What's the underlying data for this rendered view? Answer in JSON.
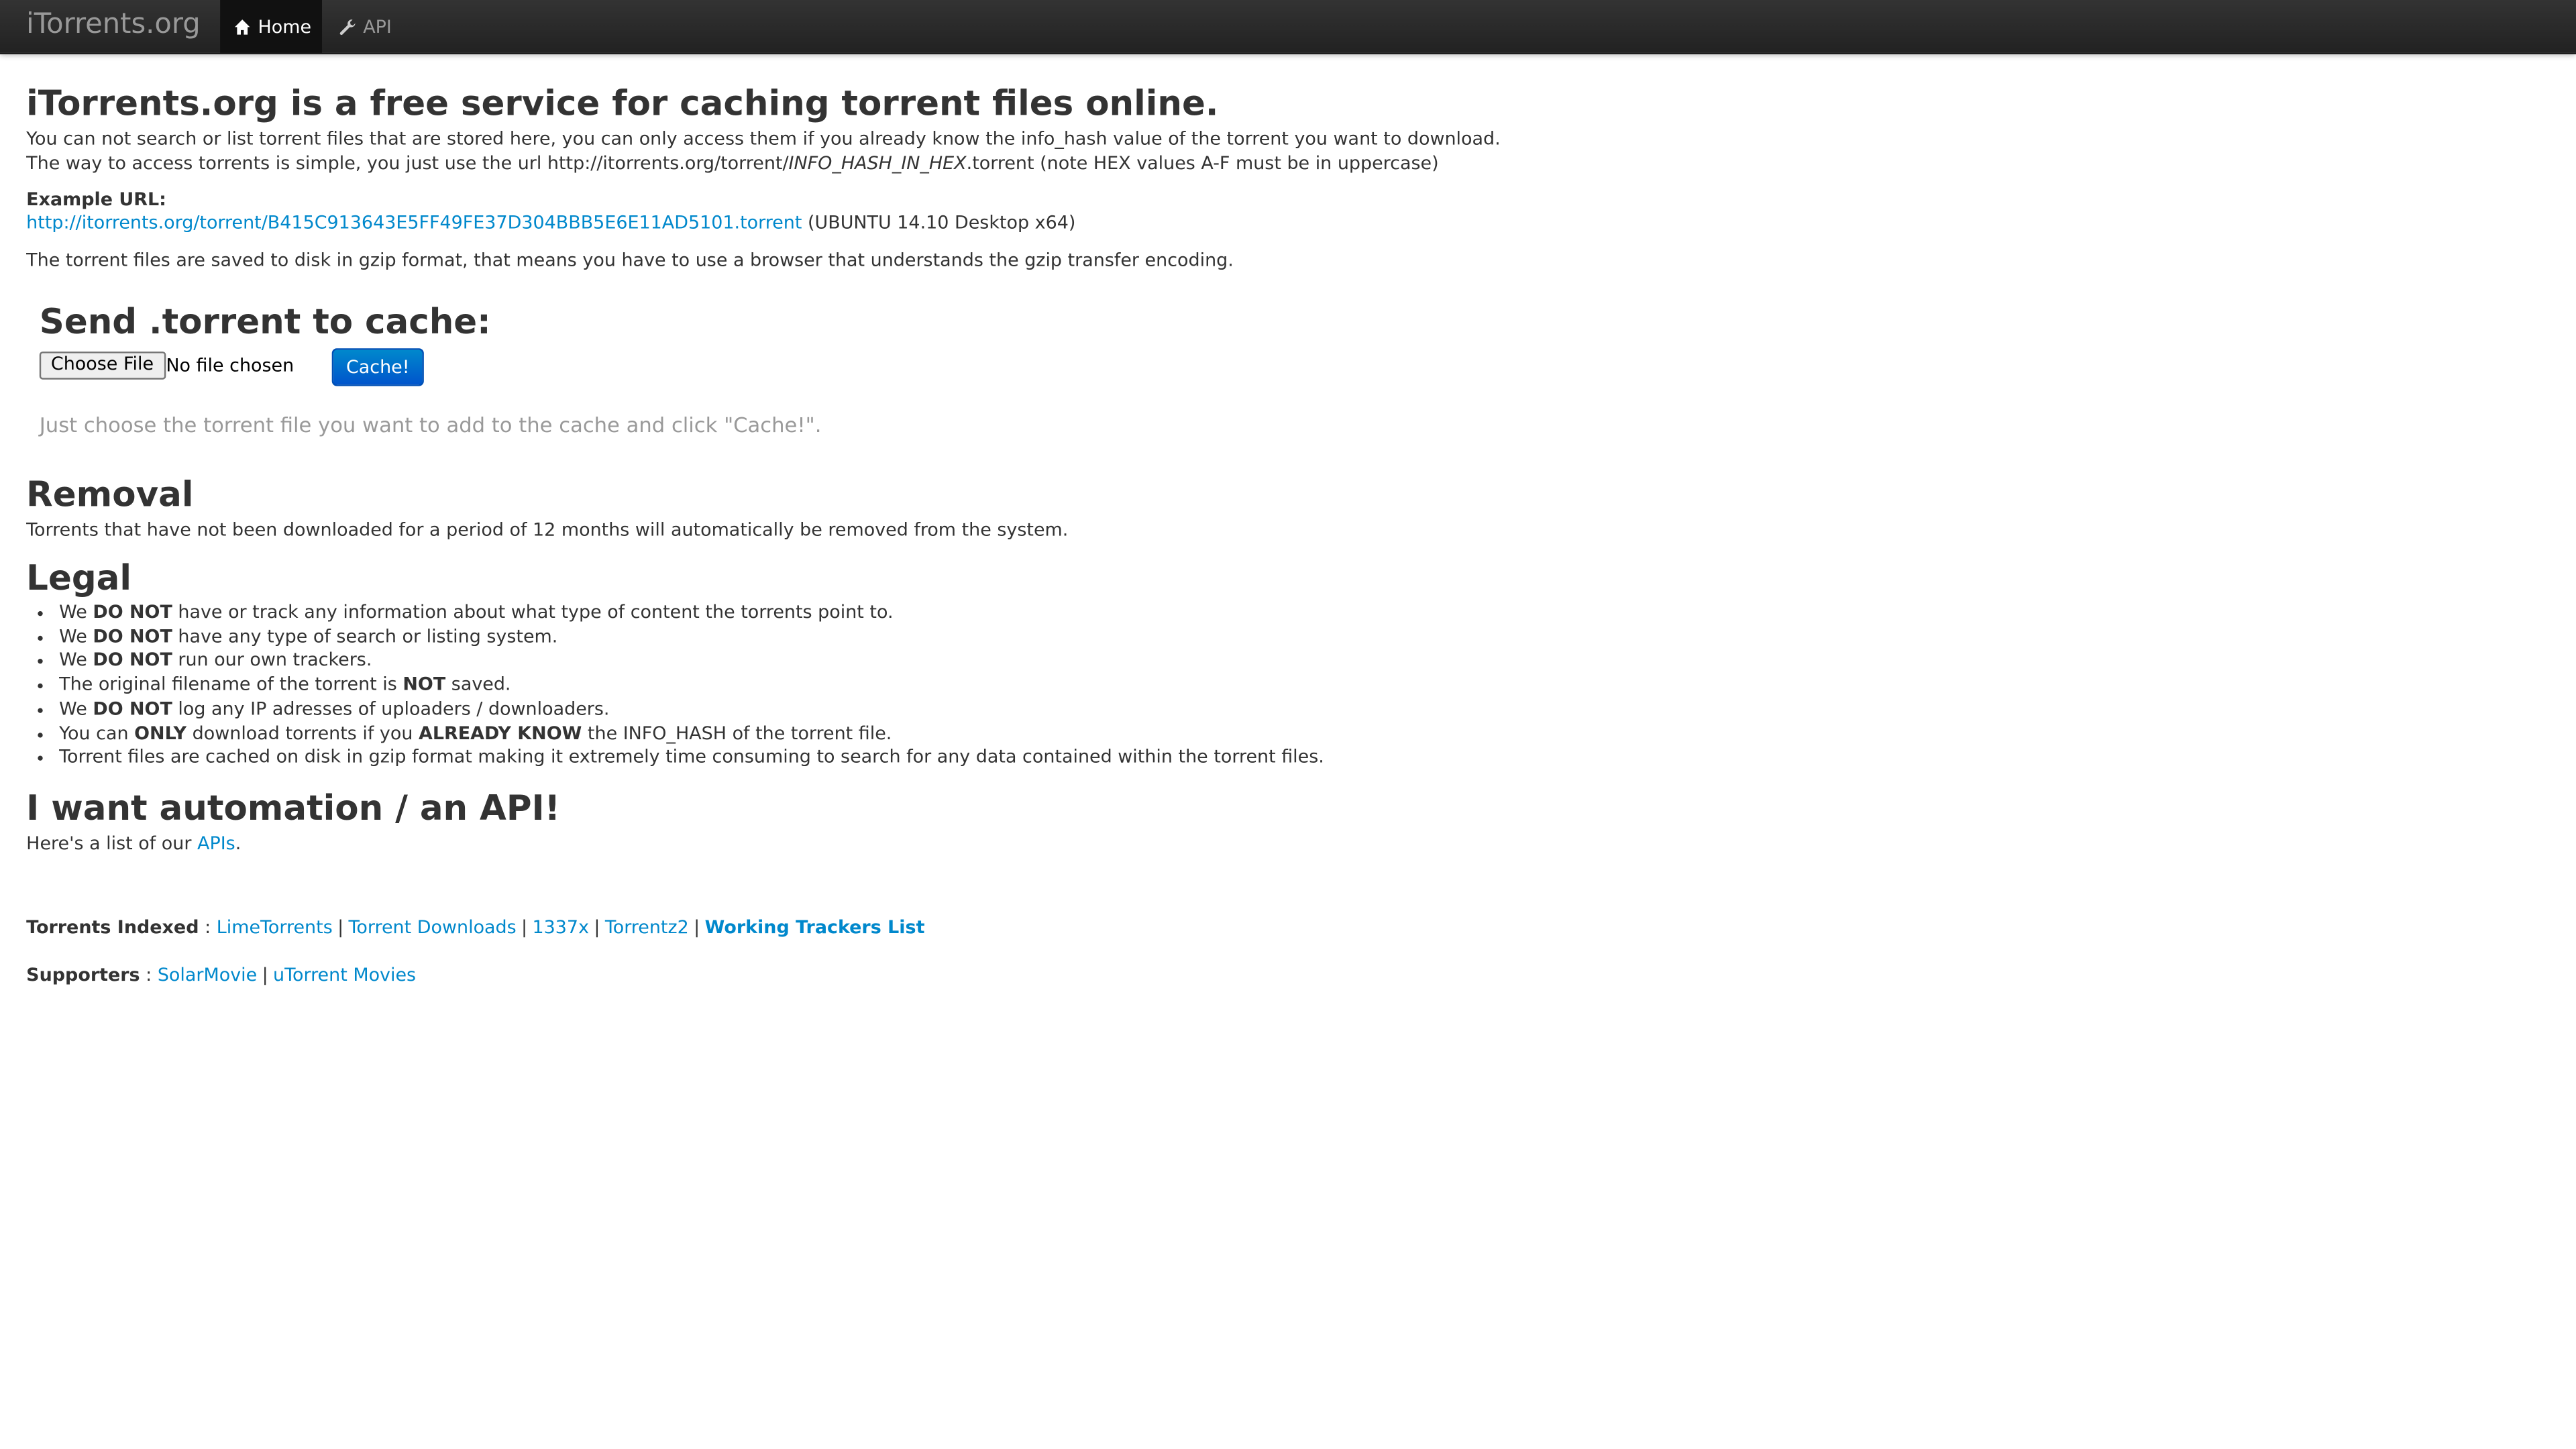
{
  "navbar": {
    "brand": "iTorrents.org",
    "items": [
      {
        "label": "Home",
        "icon": "home-icon",
        "active": true
      },
      {
        "label": "API",
        "icon": "wrench-icon",
        "active": false
      }
    ]
  },
  "intro": {
    "title": "iTorrents.org is a free service for caching torrent files online.",
    "line1": "You can not search or list torrent files that are stored here, you can only access them if you already know the info_hash value of the torrent you want to download.",
    "line2_pre": "The way to access torrents is simple, you just use the url http://itorrents.org/torrent/",
    "line2_italic": "INFO_HASH_IN_HEX",
    "line2_post": ".torrent (note HEX values A-F must be in uppercase)",
    "example_label": "Example URL:",
    "example_url": "http://itorrents.org/torrent/B415C913643E5FF49FE37D304BBB5E6E11AD5101.torrent",
    "example_note": " (UBUNTU 14.10 Desktop x64)",
    "gzip_note": "The torrent files are saved to disk in gzip format, that means you have to use a browser that understands the gzip transfer encoding."
  },
  "upload": {
    "title": "Send .torrent to cache:",
    "choose_file_label": "Choose File",
    "file_status": "No file chosen",
    "cache_button": "Cache!",
    "help": "Just choose the torrent file you want to add to the cache and click \"Cache!\"."
  },
  "removal": {
    "title": "Removal",
    "text": "Torrents that have not been downloaded for a period of 12 months will automatically be removed from the system."
  },
  "legal": {
    "title": "Legal",
    "items": [
      {
        "pre": "We ",
        "bold": "DO NOT",
        "post": " have or track any information about what type of content the torrents point to.",
        "pre2": "",
        "bold2": "",
        "post2": ""
      },
      {
        "pre": "We ",
        "bold": "DO NOT",
        "post": " have any type of search or listing system.",
        "pre2": "",
        "bold2": "",
        "post2": ""
      },
      {
        "pre": "We ",
        "bold": "DO NOT",
        "post": " run our own trackers.",
        "pre2": "",
        "bold2": "",
        "post2": ""
      },
      {
        "pre": "The original filename of the torrent is ",
        "bold": "NOT",
        "post": " saved.",
        "pre2": "",
        "bold2": "",
        "post2": ""
      },
      {
        "pre": "We ",
        "bold": "DO NOT",
        "post": " log any IP adresses of uploaders / downloaders.",
        "pre2": "",
        "bold2": "",
        "post2": ""
      },
      {
        "pre": "You can ",
        "bold": "ONLY",
        "post": " download torrents if you ",
        "pre2": "",
        "bold2": "ALREADY KNOW",
        "post2": " the INFO_HASH of the torrent file."
      },
      {
        "pre": "Torrent files are cached on disk in gzip format making it extremely time consuming to search for any data contained within the torrent files.",
        "bold": "",
        "post": "",
        "pre2": "",
        "bold2": "",
        "post2": ""
      }
    ]
  },
  "api": {
    "title": "I want automation / an API!",
    "text_pre": "Here's a list of our ",
    "link": "APIs",
    "text_post": "."
  },
  "footer": {
    "indexed_label": "Torrents Indexed",
    "colon": " : ",
    "separator": "|",
    "indexed_links": [
      "LimeTorrents",
      "Torrent Downloads",
      "1337x",
      "Torrentz2"
    ],
    "trackers_link": "Working Trackers List",
    "supporters_label": "Supporters",
    "supporter_links": [
      "SolarMovie",
      "uTorrent Movies"
    ]
  },
  "colors": {
    "link": "#0088cc",
    "navbar": "#222222",
    "button_primary": "#0066cc",
    "muted_text": "#999999"
  }
}
